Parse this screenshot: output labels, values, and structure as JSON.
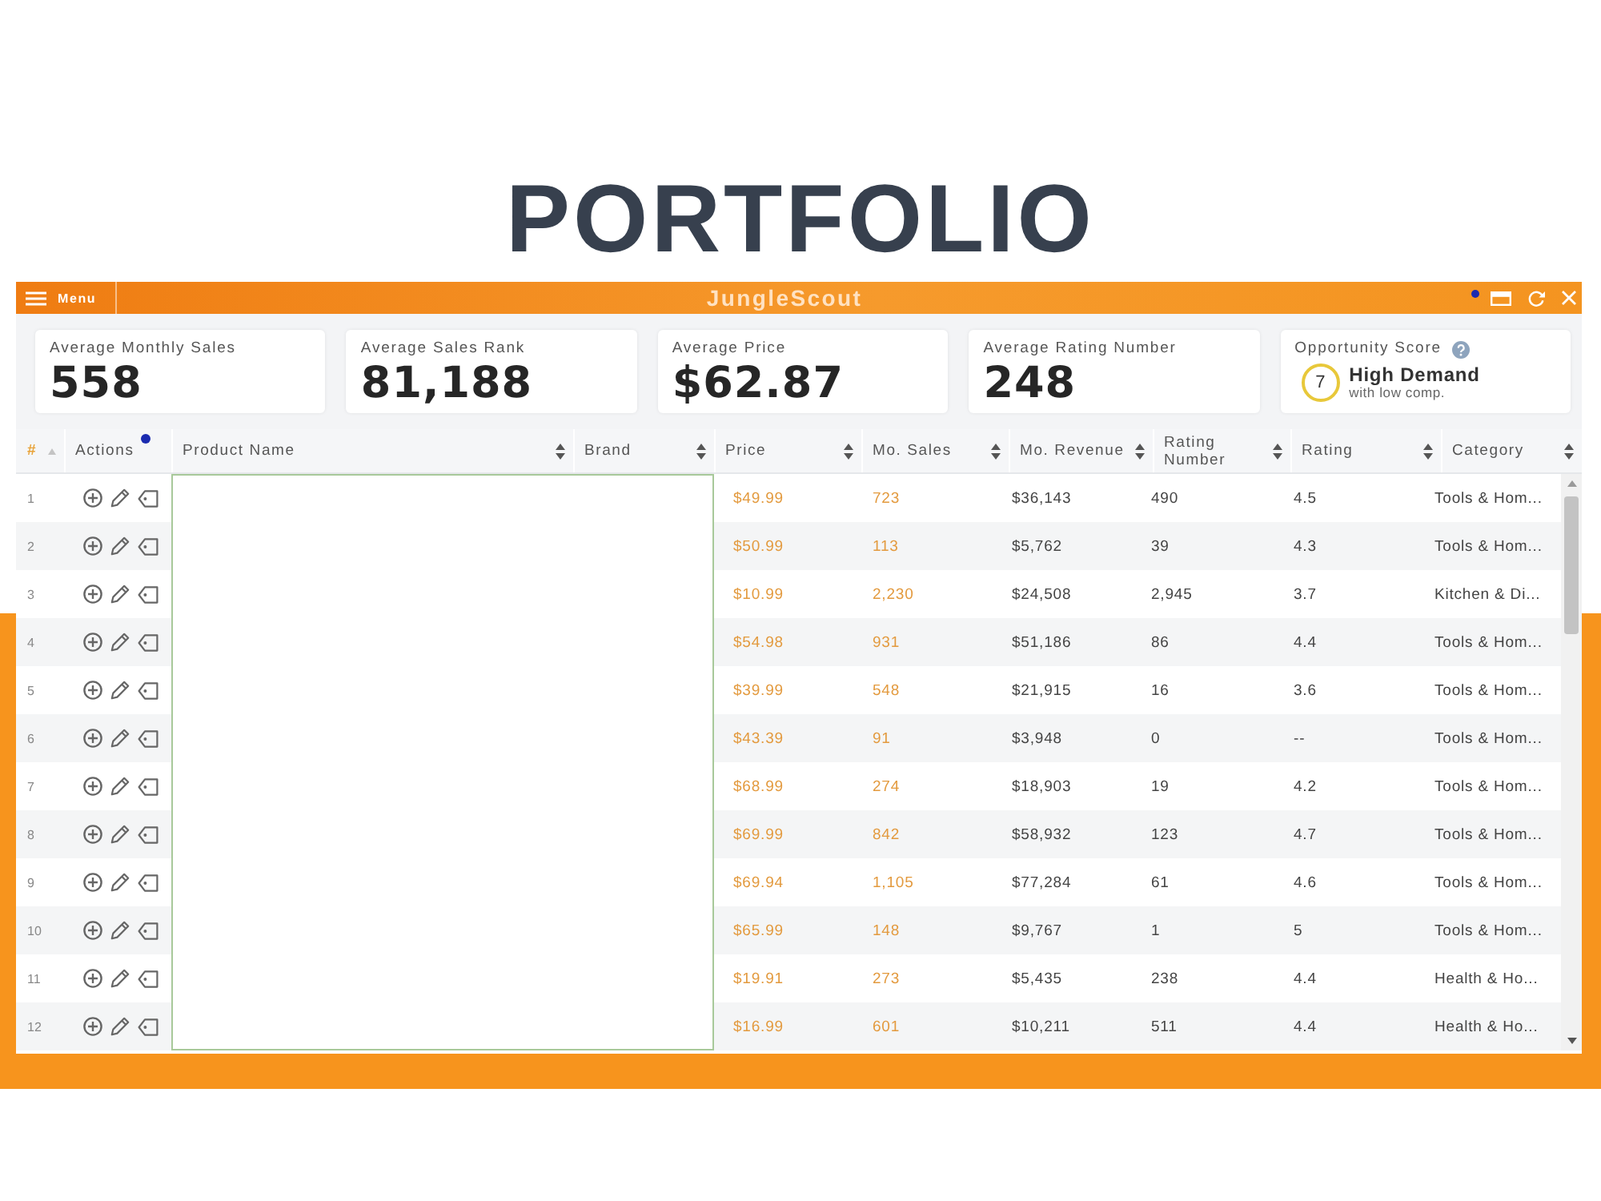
{
  "page": {
    "heading": "PORTFOLIO"
  },
  "window": {
    "menu_label": "Menu",
    "title": "JungleScout",
    "notice": true
  },
  "stats": [
    {
      "kind": "number",
      "label": "Average Monthly Sales",
      "value": "558"
    },
    {
      "kind": "number",
      "label": "Average Sales Rank",
      "value": "81,188"
    },
    {
      "kind": "number",
      "label": "Average Price",
      "value": "$62.87"
    },
    {
      "kind": "number",
      "label": "Average Rating Number",
      "value": "248"
    },
    {
      "kind": "score",
      "label": "Opportunity Score",
      "score": "7",
      "verdict": "High Demand",
      "note": "with low comp."
    }
  ],
  "table": {
    "columns": [
      {
        "label": "#",
        "sortable": false,
        "sorted": true,
        "notice": false
      },
      {
        "label": "Actions",
        "sortable": false,
        "sorted": false,
        "notice": true
      },
      {
        "label": "Product Name",
        "sortable": true,
        "sorted": false,
        "notice": false
      },
      {
        "label": "Brand",
        "sortable": true,
        "sorted": false,
        "notice": false
      },
      {
        "label": "Price",
        "sortable": true,
        "sorted": false,
        "notice": false
      },
      {
        "label": "Mo. Sales",
        "sortable": true,
        "sorted": false,
        "notice": false
      },
      {
        "label": "Mo. Revenue",
        "sortable": true,
        "sorted": false,
        "notice": false
      },
      {
        "label": "Rating Number",
        "sortable": true,
        "sorted": false,
        "notice": false
      },
      {
        "label": "Rating",
        "sortable": true,
        "sorted": false,
        "notice": false
      },
      {
        "label": "Category",
        "sortable": true,
        "sorted": false,
        "notice": false
      }
    ],
    "rows": [
      {
        "number": "1",
        "price": "$49.99",
        "mo_sales": "723",
        "mo_revenue": "$36,143",
        "rating_number": "490",
        "rating": "4.5",
        "category": "Tools & Hom..."
      },
      {
        "number": "2",
        "price": "$50.99",
        "mo_sales": "113",
        "mo_revenue": "$5,762",
        "rating_number": "39",
        "rating": "4.3",
        "category": "Tools & Hom..."
      },
      {
        "number": "3",
        "price": "$10.99",
        "mo_sales": "2,230",
        "mo_revenue": "$24,508",
        "rating_number": "2,945",
        "rating": "3.7",
        "category": "Kitchen & Di..."
      },
      {
        "number": "4",
        "price": "$54.98",
        "mo_sales": "931",
        "mo_revenue": "$51,186",
        "rating_number": "86",
        "rating": "4.4",
        "category": "Tools & Hom..."
      },
      {
        "number": "5",
        "price": "$39.99",
        "mo_sales": "548",
        "mo_revenue": "$21,915",
        "rating_number": "16",
        "rating": "3.6",
        "category": "Tools & Hom..."
      },
      {
        "number": "6",
        "price": "$43.39",
        "mo_sales": "91",
        "mo_revenue": "$3,948",
        "rating_number": "0",
        "rating": "--",
        "category": "Tools & Hom..."
      },
      {
        "number": "7",
        "price": "$68.99",
        "mo_sales": "274",
        "mo_revenue": "$18,903",
        "rating_number": "19",
        "rating": "4.2",
        "category": "Tools & Hom..."
      },
      {
        "number": "8",
        "price": "$69.99",
        "mo_sales": "842",
        "mo_revenue": "$58,932",
        "rating_number": "123",
        "rating": "4.7",
        "category": "Tools & Hom..."
      },
      {
        "number": "9",
        "price": "$69.94",
        "mo_sales": "1,105",
        "mo_revenue": "$77,284",
        "rating_number": "61",
        "rating": "4.6",
        "category": "Tools & Hom..."
      },
      {
        "number": "10",
        "price": "$65.99",
        "mo_sales": "148",
        "mo_revenue": "$9,767",
        "rating_number": "1",
        "rating": "5",
        "category": "Tools & Hom..."
      },
      {
        "number": "11",
        "price": "$19.91",
        "mo_sales": "273",
        "mo_revenue": "$5,435",
        "rating_number": "238",
        "rating": "4.4",
        "category": "Health & Ho..."
      },
      {
        "number": "12",
        "price": "$16.99",
        "mo_sales": "601",
        "mo_revenue": "$10,211",
        "rating_number": "511",
        "rating": "4.4",
        "category": "Health & Ho..."
      }
    ]
  }
}
